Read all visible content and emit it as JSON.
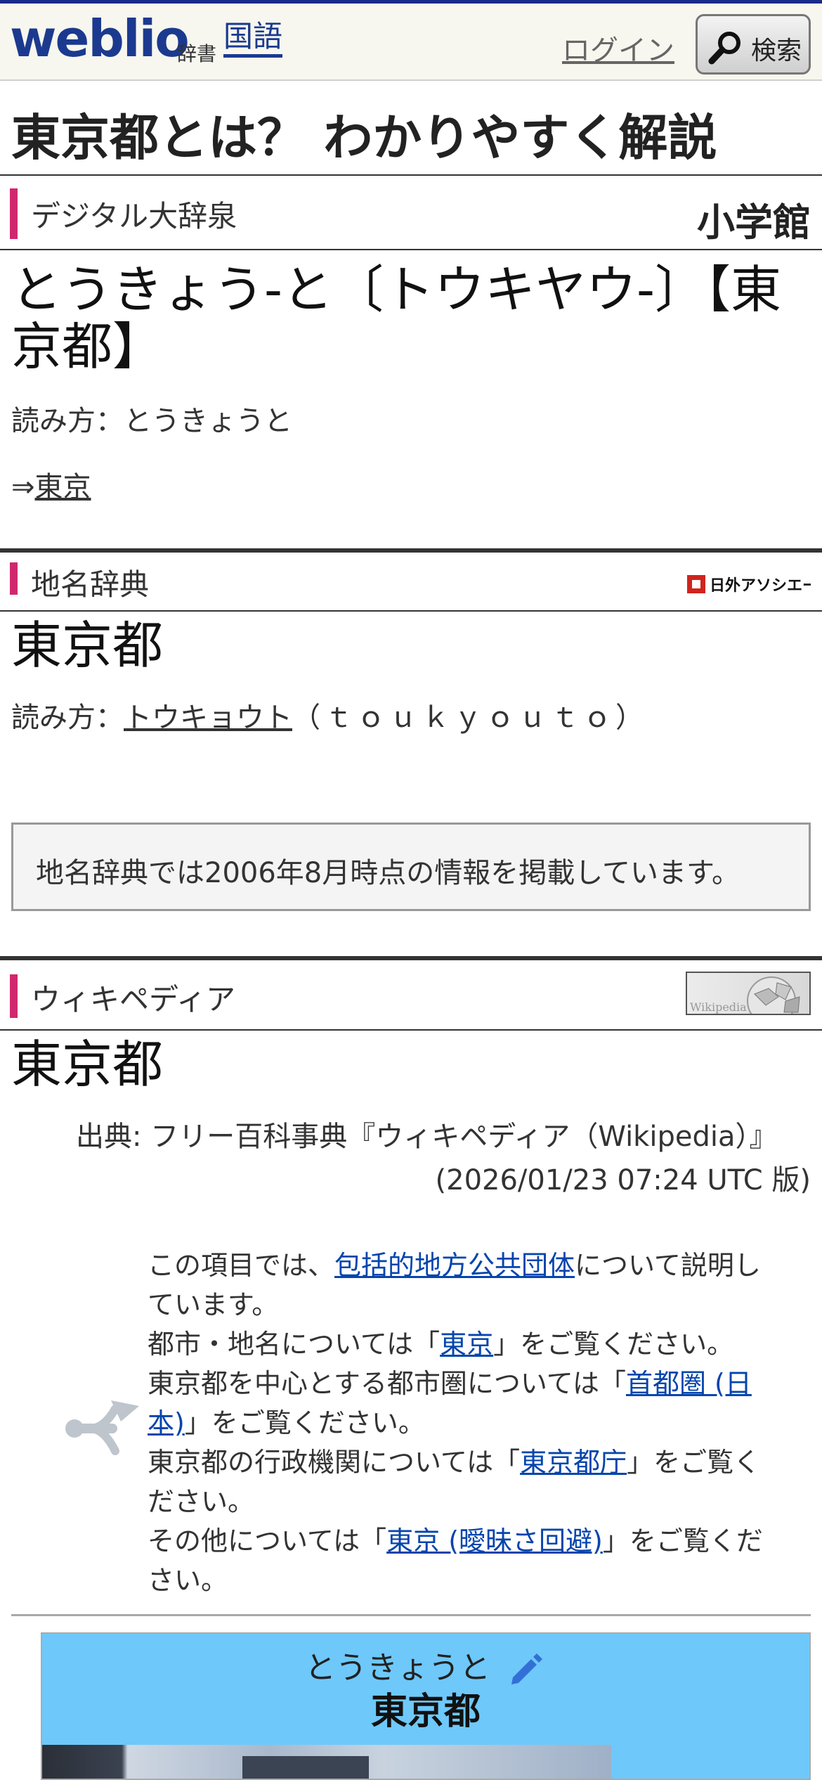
{
  "header": {
    "logo": "weblio",
    "logo_sub": "辞書",
    "nav_kokugo": "国語",
    "login": "ログイン",
    "search_label": "検索"
  },
  "page_title": "東京都とは？ わかりやすく解説",
  "daijisen": {
    "section_name": "デジタル大辞泉",
    "publisher": "小学館",
    "headword": "とうきょう-と〔トウキヤウ-〕【東京都】",
    "reading_label": "読み方：",
    "reading": "とうきょうと",
    "arrow": "⇒",
    "see_link": "東京"
  },
  "chimei": {
    "section_name": "地名辞典",
    "publisher": "日外アソシエーツ",
    "headword": "東京都",
    "reading_label": "読み方：",
    "reading_link": "トウキョウト",
    "romaji": "（ｔｏｕｋｙｏｕｔｏ）",
    "notice": "地名辞典では2006年8月時点の情報を掲載しています。"
  },
  "wikipedia": {
    "section_name": "ウィキペディア",
    "logo_text": "Wikipedia",
    "headword": "東京都",
    "source": "出典: フリー百科事典『ウィキペディア（Wikipedia）』",
    "version": "(2026/01/23 07:24 UTC 版)",
    "hatnote": {
      "l1_pre": "この項目では、",
      "l1_link": "包括的地方公共団体",
      "l1_post": "について説明しています。",
      "l2_pre": "都市・地名については「",
      "l2_link": "東京",
      "l2_post": "」をご覧ください。",
      "l3_pre": "東京都を中心とする都市圏については「",
      "l3_link": "首都圏 (日本)",
      "l3_post": "」をご覧ください。",
      "l4_pre": "東京都の行政機関については「",
      "l4_link": "東京都庁",
      "l4_post": "」をご覧ください。",
      "l5_pre": "その他については「",
      "l5_link": "東京 (曖昧さ回避)",
      "l5_post": "」をご覧ください。"
    },
    "infobox": {
      "kana": "とうきょうと",
      "name": "東京都"
    }
  },
  "colors": {
    "brand": "#1b3a8f",
    "section_accent": "#d0286e",
    "link": "#0645ad",
    "infobox_bg": "#6ec8fa"
  }
}
